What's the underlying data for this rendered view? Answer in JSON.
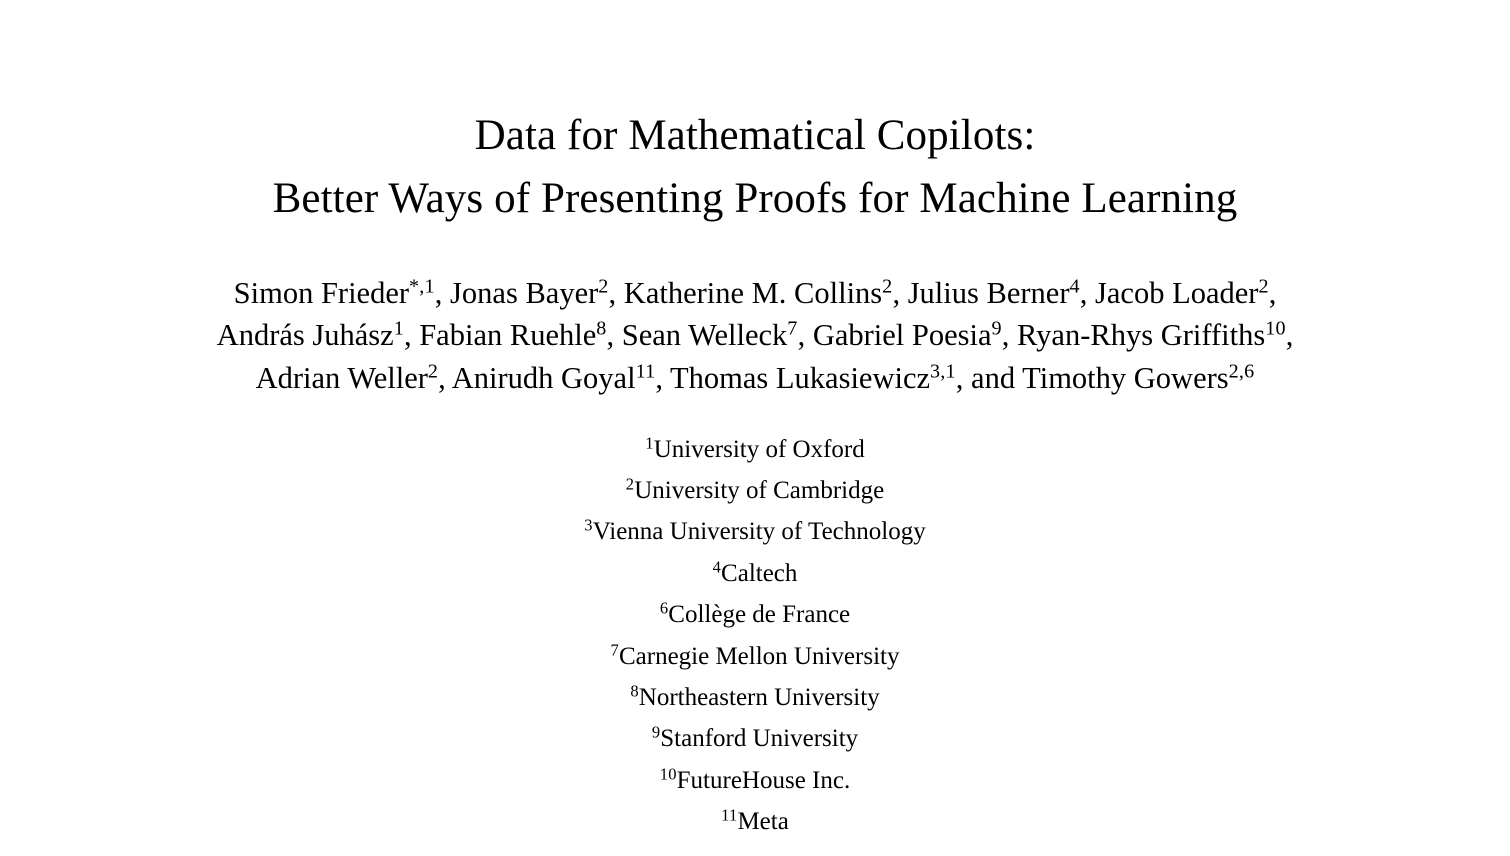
{
  "document": {
    "type": "academic-paper-title-page",
    "background_color": "#ffffff",
    "text_color": "#000000"
  },
  "title": {
    "lines": [
      "Data for Mathematical Copilots:",
      "Better Ways of Presenting Proofs for Machine Learning"
    ],
    "full": "Data for Mathematical Copilots: Better Ways of Presenting Proofs for Machine Learning"
  },
  "authors": {
    "lines": [
      [
        {
          "name": "Simon Frieder",
          "mark": "*,1",
          "sep": ", "
        },
        {
          "name": "Jonas Bayer",
          "mark": "2",
          "sep": ", "
        },
        {
          "name": "Katherine M. Collins",
          "mark": "2",
          "sep": ", "
        },
        {
          "name": "Julius Berner",
          "mark": "4",
          "sep": ", "
        },
        {
          "name": "Jacob Loader",
          "mark": "2",
          "sep": ","
        }
      ],
      [
        {
          "name": "András Juhász",
          "mark": "1",
          "sep": ", "
        },
        {
          "name": "Fabian Ruehle",
          "mark": "8",
          "sep": ", "
        },
        {
          "name": "Sean Welleck",
          "mark": "7",
          "sep": ", "
        },
        {
          "name": "Gabriel Poesia",
          "mark": "9",
          "sep": ", "
        },
        {
          "name": "Ryan-Rhys Griffiths",
          "mark": "10",
          "sep": ","
        }
      ],
      [
        {
          "name": "Adrian Weller",
          "mark": "2",
          "sep": ", "
        },
        {
          "name": "Anirudh Goyal",
          "mark": "11",
          "sep": ", "
        },
        {
          "name": "Thomas Lukasiewicz",
          "mark": "3,1",
          "sep": ", and "
        },
        {
          "name": "Timothy Gowers",
          "mark": "2,6",
          "sep": ""
        }
      ]
    ],
    "corresponding_author_symbol": "*"
  },
  "affiliations": [
    {
      "mark": "1",
      "name": "University of Oxford"
    },
    {
      "mark": "2",
      "name": "University of Cambridge"
    },
    {
      "mark": "3",
      "name": "Vienna University of Technology"
    },
    {
      "mark": "4",
      "name": "Caltech"
    },
    {
      "mark": "6",
      "name": "Collège de France"
    },
    {
      "mark": "7",
      "name": "Carnegie Mellon University"
    },
    {
      "mark": "8",
      "name": "Northeastern University"
    },
    {
      "mark": "9",
      "name": "Stanford University"
    },
    {
      "mark": "10",
      "name": "FutureHouse Inc."
    },
    {
      "mark": "11",
      "name": "Meta"
    }
  ]
}
